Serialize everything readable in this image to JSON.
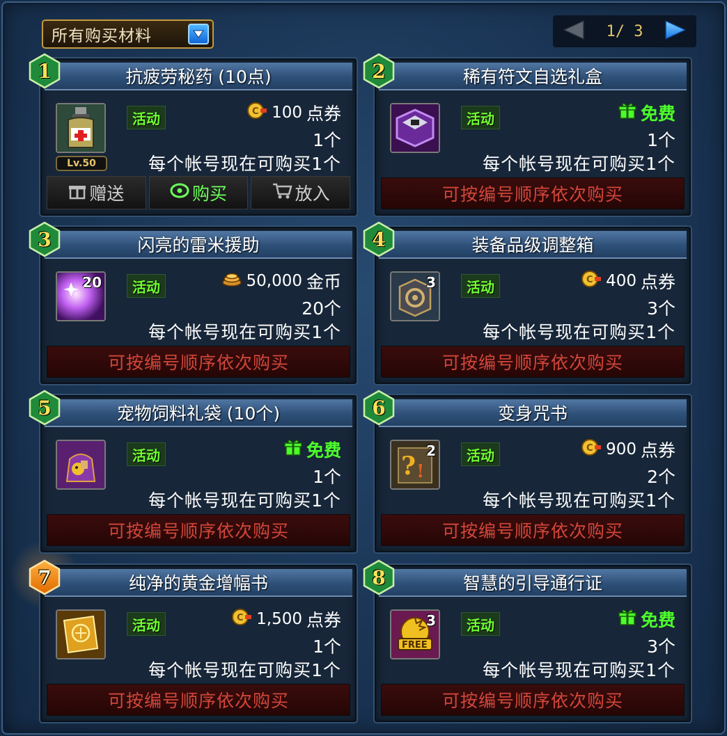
{
  "filter": {
    "label": "所有购买材料"
  },
  "pager": {
    "text": "1/ 3"
  },
  "common": {
    "event_tag": "活动",
    "order_label": "可按编号顺序依次购买",
    "limit_text": "每个帐号现在可购买1个"
  },
  "actions": {
    "gift": "赠送",
    "buy": "购买",
    "cart": "放入"
  },
  "items": [
    {
      "num": "1",
      "title": "抗疲劳秘药 (10点)",
      "price_amount": "100",
      "price_unit": "点券",
      "qty": "1个",
      "level": "Lv.50",
      "stack": ""
    },
    {
      "num": "2",
      "title": "稀有符文自选礼盒",
      "price_amount": "",
      "price_unit": "免费",
      "qty": "1个",
      "stack": ""
    },
    {
      "num": "3",
      "title": "闪亮的雷米援助",
      "price_amount": "50,000",
      "price_unit": "金币",
      "qty": "20个",
      "stack": "20"
    },
    {
      "num": "4",
      "title": "装备品级调整箱",
      "price_amount": "400",
      "price_unit": "点券",
      "qty": "3个",
      "stack": "3"
    },
    {
      "num": "5",
      "title": "宠物饲料礼袋 (10个)",
      "price_amount": "",
      "price_unit": "免费",
      "qty": "1个",
      "stack": ""
    },
    {
      "num": "6",
      "title": "变身咒书",
      "price_amount": "900",
      "price_unit": "点券",
      "qty": "2个",
      "stack": "2"
    },
    {
      "num": "7",
      "title": "纯净的黄金增幅书",
      "price_amount": "1,500",
      "price_unit": "点券",
      "qty": "1个",
      "stack": ""
    },
    {
      "num": "8",
      "title": "智慧的引导通行证",
      "price_amount": "",
      "price_unit": "免费",
      "qty": "3个",
      "stack": "3",
      "icon_text": "FREE"
    }
  ],
  "colors": {
    "badge_green": "#1f8a3a",
    "badge_orange": "#f08a12",
    "free_green": "#4dff2a",
    "order_red": "#d2463a"
  }
}
